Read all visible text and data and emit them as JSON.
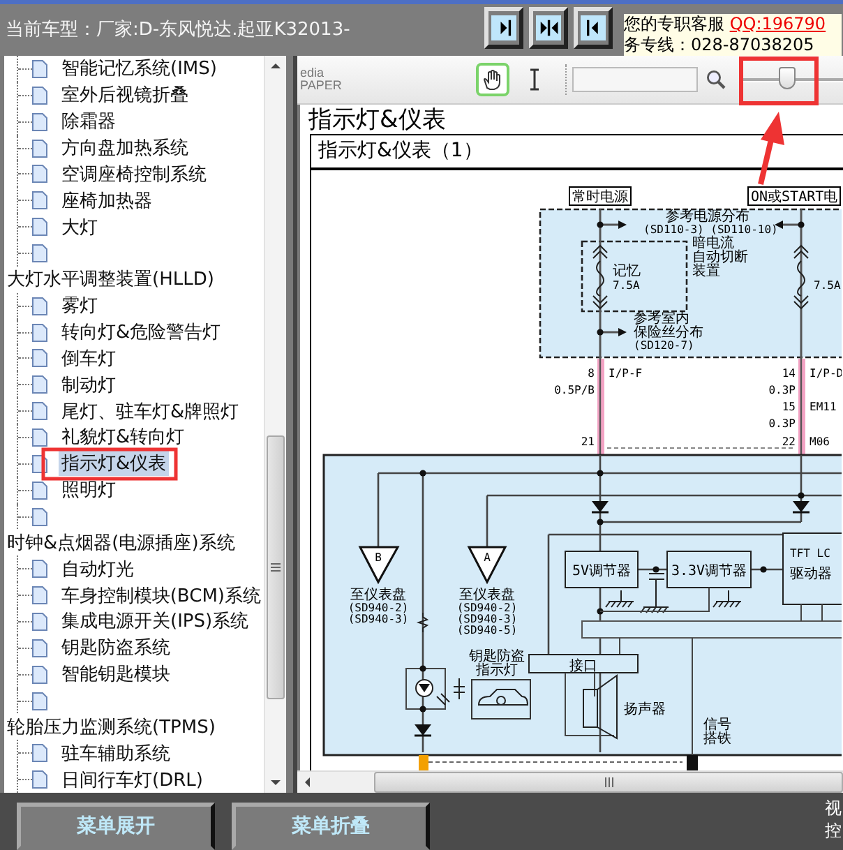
{
  "header": {
    "car_model": "当前车型：厂家:D-东风悦达.起亚K32013-",
    "service_label": "您的专职客服",
    "qq_link": "QQ:196790",
    "hotline": "务专线：028-87038205"
  },
  "tree": [
    {
      "children": [
        {
          "label": "智能记忆系统(IMS)",
          "selected": false
        },
        {
          "label": "室外后视镜折叠",
          "selected": false
        },
        {
          "label": "除霜器",
          "selected": false
        },
        {
          "label": "方向盘加热系统",
          "selected": false
        },
        {
          "label": "空调座椅控制系统",
          "selected": false
        },
        {
          "label": "座椅加热器",
          "selected": false
        },
        {
          "label": "大灯",
          "selected": false
        },
        {
          "selected": false
        }
      ]
    },
    {
      "label": "大灯水平调整装置(HLLD)",
      "children": [
        {
          "label": "雾灯",
          "selected": false
        },
        {
          "label": "转向灯&危险警告灯",
          "selected": false
        },
        {
          "label": "倒车灯",
          "selected": false
        },
        {
          "label": "制动灯",
          "selected": false
        },
        {
          "label": "尾灯、驻车灯&牌照灯",
          "selected": false
        },
        {
          "label": "礼貌灯&转向灯",
          "selected": false
        },
        {
          "label": "指示灯&仪表",
          "selected": true
        },
        {
          "label": "照明灯",
          "selected": false
        },
        {
          "selected": false
        }
      ]
    },
    {
      "label": "时钟&点烟器(电源插座)系统",
      "children": [
        {
          "label": "自动灯光",
          "selected": false
        },
        {
          "label": "车身控制模块(BCM)系统",
          "selected": false
        },
        {
          "label": "集成电源开关(IPS)系统",
          "selected": false
        },
        {
          "label": "钥匙防盗系统",
          "selected": false
        },
        {
          "label": "智能钥匙模块",
          "selected": false
        },
        {
          "selected": false
        }
      ]
    },
    {
      "label": "轮胎压力监测系统(TPMS)",
      "children": [
        {
          "label": "驻车辅助系统",
          "selected": false
        },
        {
          "label": "日间行车灯(DRL)",
          "selected": false
        }
      ]
    }
  ],
  "viewer": {
    "logo": [
      "edia",
      "PAPER"
    ],
    "tools": [
      {
        "kind": "hand",
        "selected": true
      },
      {
        "kind": "text",
        "selected": false
      }
    ],
    "zoom_slider": {
      "level": 0.46
    },
    "page_title": "指示灯&仪表",
    "figure_title": "指示灯&仪表（1）",
    "diagram_labels": [
      "常时电源",
      "ON或START电",
      "参考电源分布",
      "(SD110-3) (SD110-10)",
      "暗电流",
      "自动切断",
      "装置",
      "记忆",
      "7.5A",
      "7.5A",
      "参考室内",
      "保险丝分布",
      "(SD120-7)",
      "8",
      "I/P-F",
      "0.5P/B",
      "21",
      "14",
      "I/P-D",
      "0.3P",
      "15",
      "EM11",
      "0.3P",
      "22",
      "M06",
      "B",
      "至仪表盘",
      "(SD940-2)",
      "(SD940-3)",
      "A",
      "至仪表盘",
      "(SD940-2)",
      "(SD940-3)",
      "(SD940-5)",
      "5V调节器",
      "3.3V调节器",
      "TFT LC",
      "驱动器",
      "接口",
      "钥匙防盗",
      "指示灯",
      "扬声器",
      "信号",
      "搭铁"
    ]
  },
  "footer": {
    "buttons": [
      "菜单展开",
      "菜单折叠"
    ],
    "side_text": [
      "视",
      "控"
    ]
  }
}
